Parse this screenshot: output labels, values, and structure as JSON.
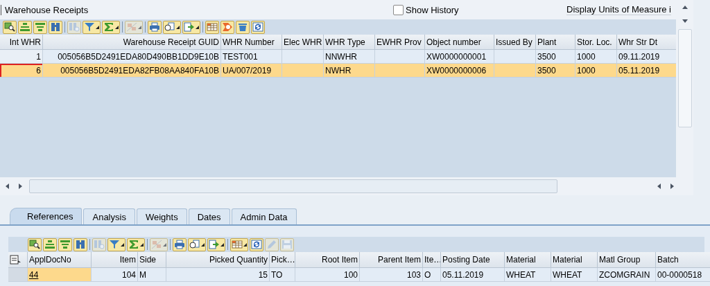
{
  "header": {
    "title": "Warehouse Receipts",
    "show_history": {
      "label": "Show History",
      "checked": false
    },
    "units_label": "Display Units of Measure i"
  },
  "toolbar": [
    {
      "disabled": false,
      "dropdown": false
    },
    {
      "disabled": false,
      "dropdown": false
    },
    {
      "disabled": false,
      "dropdown": false
    },
    {
      "disabled": false,
      "dropdown": false
    },
    {
      "disabled": true,
      "dropdown": false
    },
    {
      "disabled": false,
      "dropdown": true
    },
    {
      "disabled": false,
      "dropdown": true
    },
    {
      "disabled": true,
      "dropdown": true
    },
    {
      "disabled": false,
      "dropdown": false
    },
    {
      "disabled": false,
      "dropdown": true
    },
    {
      "disabled": false,
      "dropdown": true
    },
    {
      "disabled": false,
      "dropdown": false
    },
    {
      "disabled": false,
      "dropdown": false
    },
    {
      "disabled": false,
      "dropdown": false
    },
    {
      "disabled": false,
      "dropdown": false
    }
  ],
  "receipts": {
    "columns": [
      "Int WHR",
      "Warehouse Receipt GUID",
      "WHR Number",
      "Elec WHR",
      "WHR Type",
      "EWHR Prov",
      "Object number",
      "Issued By",
      "Plant",
      "Stor. Loc.",
      "Whr Str Dt"
    ],
    "rows": [
      {
        "selected": false,
        "cells": [
          "1",
          "005056B5D2491EDA80D490BB1DD9E10B",
          "TEST001",
          "",
          "NNWHR",
          "",
          "XW0000000001",
          "",
          "3500",
          "1000",
          "09.11.2019"
        ]
      },
      {
        "selected": true,
        "cells": [
          "6",
          "005056B5D2491EDA82FB08AA840FA10B",
          "UA/007/2019",
          "",
          "NWHR",
          "",
          "XW0000000006",
          "",
          "3500",
          "1000",
          "05.11.2019"
        ]
      }
    ]
  },
  "tabs": [
    {
      "label": "References",
      "selected": true
    },
    {
      "label": "Analysis",
      "selected": false
    },
    {
      "label": "Weights",
      "selected": false
    },
    {
      "label": "Dates",
      "selected": false
    },
    {
      "label": "Admin Data",
      "selected": false
    }
  ],
  "detail_toolbar": [
    {
      "disabled": false,
      "dropdown": false
    },
    {
      "disabled": false,
      "dropdown": false
    },
    {
      "disabled": false,
      "dropdown": false
    },
    {
      "disabled": false,
      "dropdown": false
    },
    {
      "disabled": true,
      "dropdown": false
    },
    {
      "disabled": false,
      "dropdown": true
    },
    {
      "disabled": false,
      "dropdown": true
    },
    {
      "disabled": true,
      "dropdown": true
    },
    {
      "disabled": false,
      "dropdown": false
    },
    {
      "disabled": false,
      "dropdown": true
    },
    {
      "disabled": false,
      "dropdown": true
    },
    {
      "disabled": false,
      "dropdown": true
    },
    {
      "disabled": false,
      "dropdown": false
    },
    {
      "disabled": true,
      "dropdown": false
    },
    {
      "disabled": true,
      "dropdown": false
    }
  ],
  "references": {
    "columns": [
      "ApplDocNo",
      "Item",
      "Side",
      "Picked Quantity",
      "Pick…",
      "Root Item",
      "Parent Item",
      "Ite…",
      "Posting Date",
      "Material",
      "Material",
      "Matl Group",
      "Batch"
    ],
    "rows": [
      {
        "cells": [
          "44",
          "104",
          "M",
          "15",
          "TO",
          "100",
          "103",
          "O",
          "05.11.2019",
          "WHEAT",
          "WHEAT",
          "ZCOMGRAIN",
          "00-0000518"
        ]
      }
    ]
  }
}
